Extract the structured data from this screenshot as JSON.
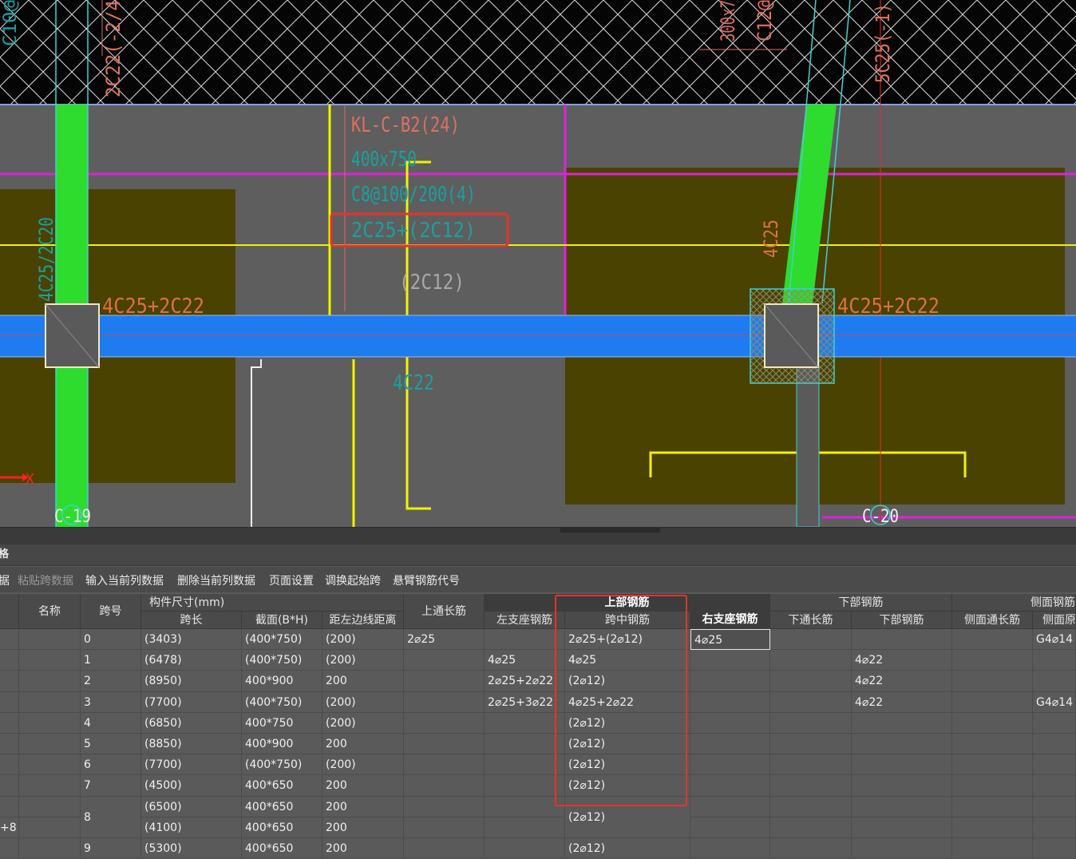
{
  "cad": {
    "labels": {
      "beam_name": "KL-C-B2(24)",
      "beam_section": "400x750",
      "beam_stirrup": "C8@100/200(4)",
      "beam_long": "2C25+(2C12)",
      "span_middle": "(2C12)",
      "bottom_bar": "4C22",
      "col_left_long": "4C25/2C20",
      "support_left": "4C25+2C22",
      "support_right": "4C25+2C22",
      "vertical_right": "4C25",
      "col_left_name": "C-19",
      "col_right_name": "C-20",
      "top_left_text": "2C22(-2/4",
      "top_left_small": "C10@",
      "top_mid_a": "300x7",
      "top_mid_b": "C12@",
      "top_right": "5C25(-1)",
      "axis_x": "X"
    }
  },
  "panel": {
    "title": "格"
  },
  "toolbar": {
    "items": [
      "据",
      "粘贴跨数据",
      "输入当前列数据",
      "删除当前列数据",
      "页面设置",
      "调换起始跨",
      "悬臂钢筋代号"
    ]
  },
  "table": {
    "headers": {
      "c0": "",
      "name": "名称",
      "span_no": "跨号",
      "size_group": "构件尺寸(mm)",
      "span_len": "跨长",
      "section": "截面(B*H)",
      "edge_dist": "距左边线距离",
      "top_through": "上通长筋",
      "top_group": "上部钢筋",
      "left_support": "左支座钢筋",
      "mid_span": "跨中钢筋",
      "right_support": "右支座钢筋",
      "bottom_group": "下部钢筋",
      "bottom_through": "下通长筋",
      "bottom_bar": "下部钢筋",
      "side_group": "侧面钢筋",
      "side_through": "侧面通长筋",
      "side_orig": "侧面原"
    },
    "rows": [
      {
        "span": "0",
        "len": "(3403)",
        "sec": "(400*750)",
        "dist": "(200)",
        "top": "2⌀25",
        "left": "",
        "mid": "2⌀25+(2⌀12)",
        "right": "4⌀25",
        "bthru": "",
        "bbar": "",
        "sthru": "",
        "sorig": "G4⌀14"
      },
      {
        "span": "1",
        "len": "(6478)",
        "sec": "(400*750)",
        "dist": "(200)",
        "top": "",
        "left": "4⌀25",
        "mid": "4⌀25",
        "right": "",
        "bthru": "",
        "bbar": "4⌀22",
        "sthru": "",
        "sorig": ""
      },
      {
        "span": "2",
        "len": "(8950)",
        "sec": "400*900",
        "dist": "200",
        "top": "",
        "left": "2⌀25+2⌀22",
        "mid": "(2⌀12)",
        "right": "",
        "bthru": "",
        "bbar": "4⌀22",
        "sthru": "",
        "sorig": ""
      },
      {
        "span": "3",
        "len": "(7700)",
        "sec": "(400*750)",
        "dist": "(200)",
        "top": "",
        "left": "2⌀25+3⌀22",
        "mid": "4⌀25+2⌀22",
        "right": "",
        "bthru": "",
        "bbar": "4⌀22",
        "sthru": "",
        "sorig": "G4⌀14"
      },
      {
        "span": "4",
        "len": "(6850)",
        "sec": "400*750",
        "dist": "(200)",
        "top": "",
        "left": "",
        "mid": "(2⌀12)",
        "right": "",
        "bthru": "",
        "bbar": "",
        "sthru": "",
        "sorig": ""
      },
      {
        "span": "5",
        "len": "(8850)",
        "sec": "400*900",
        "dist": "200",
        "top": "",
        "left": "",
        "mid": "(2⌀12)",
        "right": "",
        "bthru": "",
        "bbar": "",
        "sthru": "",
        "sorig": ""
      },
      {
        "span": "6",
        "len": "(7700)",
        "sec": "(400*750)",
        "dist": "(200)",
        "top": "",
        "left": "",
        "mid": "(2⌀12)",
        "right": "",
        "bthru": "",
        "bbar": "",
        "sthru": "",
        "sorig": ""
      },
      {
        "span": "7",
        "len": "(4500)",
        "sec": "400*650",
        "dist": "200",
        "top": "",
        "left": "",
        "mid": "(2⌀12)",
        "right": "",
        "bthru": "",
        "bbar": "",
        "sthru": "",
        "sorig": ""
      },
      {
        "span": "8",
        "len": "(6500)",
        "sec": "400*650",
        "dist": "200",
        "top": "",
        "left": "",
        "mid": "",
        "right": "",
        "bthru": "",
        "bbar": "",
        "sthru": "",
        "sorig": ""
      },
      {
        "span": "",
        "len": "(4100)",
        "sec": "400*650",
        "dist": "200",
        "top": "",
        "left": "",
        "mid": "(2⌀12)",
        "right": "",
        "bthru": "",
        "bbar": "",
        "sthru": "",
        "sorig": ""
      },
      {
        "span": "9",
        "len": "(5300)",
        "sec": "400*650",
        "dist": "200",
        "top": "",
        "left": "",
        "mid": "(2⌀12)",
        "right": "",
        "bthru": "",
        "bbar": "",
        "sthru": "",
        "sorig": ""
      }
    ],
    "left_edge_label": "+8"
  }
}
